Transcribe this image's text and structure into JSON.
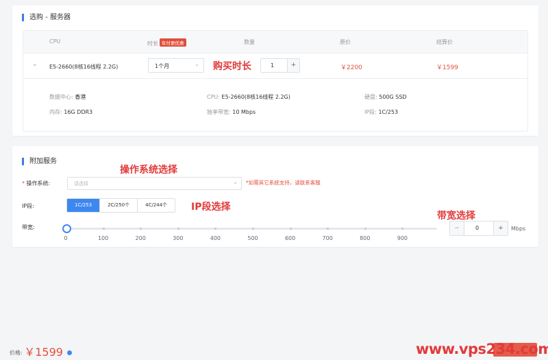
{
  "server_section": {
    "title": "选购 - 服务器",
    "columns": {
      "cpu": "CPU",
      "duration": "时长",
      "duration_badge": "年付更优惠",
      "quantity": "数量",
      "original_price": "原价",
      "final_price": "结算价"
    },
    "row": {
      "cpu": "E5-2660(8核16线程 2.2G)",
      "duration": "1个月",
      "quantity": "1",
      "original_price": "￥2200",
      "final_price": "￥1599"
    },
    "details": {
      "datacenter_label": "数据中心:",
      "datacenter": "香港",
      "cpu_label": "CPU:",
      "cpu": "E5-2660(8核16线程 2.2G)",
      "disk_label": "硬盘:",
      "disk": "500G SSD",
      "memory_label": "内存:",
      "memory": "16G DDR3",
      "bandwidth_label": "独享带宽:",
      "bandwidth": "10 Mbps",
      "ip_label": "IP段:",
      "ip": "1C/253"
    }
  },
  "addon_section": {
    "title": "附加服务",
    "os_label": "操作系统:",
    "os_placeholder": "请选择",
    "os_hint": "*如需其它系统支持，请联系客服",
    "ip_label": "IP段:",
    "ip_options": [
      "1C/253",
      "2C/250个",
      "4C/244个"
    ],
    "ip_selected": "1C/253",
    "bandwidth_label": "带宽:",
    "bandwidth_ticks": [
      "0",
      "100",
      "200",
      "300",
      "400",
      "500",
      "600",
      "700",
      "800",
      "900"
    ],
    "bandwidth_value": "0",
    "bandwidth_unit": "Mbps"
  },
  "annotations": {
    "duration": "购买时长",
    "os": "操作系统选择",
    "ip": "IP段选择",
    "bandwidth": "带宽选择"
  },
  "footer": {
    "price_label": "价格:",
    "price": "￥1599"
  },
  "watermark": "www.vps234.com",
  "colors": {
    "accent": "#3d88f0",
    "price": "#e24e3b",
    "annotation": "#e23a3a"
  }
}
